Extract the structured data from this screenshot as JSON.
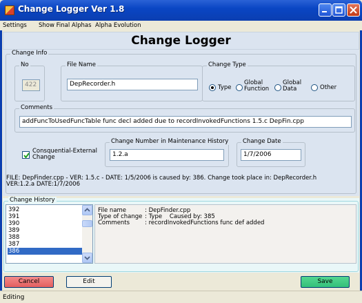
{
  "window": {
    "title": "Change Logger Ver 1.8"
  },
  "menu": {
    "items": [
      "Settings",
      "Show Final Alphas",
      "Alpha Evolution"
    ]
  },
  "header": {
    "title": "Change Logger"
  },
  "change_info": {
    "group_label": "Change Info",
    "no": {
      "label": "No",
      "value": "422"
    },
    "file_name": {
      "label": "File Name",
      "value": "DepRecorder.h"
    },
    "change_type": {
      "label": "Change Type",
      "options": [
        {
          "label": "Type",
          "selected": true
        },
        {
          "label": "Global Function",
          "line1": "Global",
          "line2": "Function",
          "selected": false
        },
        {
          "label": "Global Data",
          "line1": "Global",
          "line2": "Data",
          "selected": false
        },
        {
          "label": "Other",
          "selected": false
        }
      ]
    },
    "comments": {
      "label": "Comments",
      "value": "addFuncToUsedFuncTable func decl added due to recordInvokedFunctions 1.5.c DepFin.cpp"
    },
    "consequential": {
      "line1": "Consquential-External",
      "line2": "Change",
      "checked": true
    },
    "maintenance_number": {
      "label": "Change Number in Maintenance History",
      "value": "1.2.a"
    },
    "change_date": {
      "label": "Change Date",
      "value": "1/7/2006"
    },
    "summary_line1": "FILE: DepFinder.cpp - VER: 1.5.c - DATE: 1/5/2006 is caused by: 386. Change took place in: DepRecorder.h",
    "summary_line2": "VER:1.2.a DATE:1/7/2006"
  },
  "change_history": {
    "group_label": "Change History",
    "items": [
      "392",
      "391",
      "390",
      "389",
      "388",
      "387",
      "386"
    ],
    "selected": "386",
    "details": {
      "file_name_label": "File name",
      "file_name_value": ": DepFinder.cpp",
      "type_label": "Type of change",
      "type_value": ": Type    Caused by: 385",
      "comments_label": "Comments",
      "comments_value": ": recordInvokedFunctions func def added"
    }
  },
  "buttons": {
    "cancel": "Cancel",
    "edit": "Edit",
    "save": "Save"
  },
  "status": {
    "text": "Editing"
  },
  "colors": {
    "title_bar": "#0b46c4",
    "panel": "#dbe4f0",
    "history_panel": "#e9f7f8",
    "cancel": "#e35f5f",
    "save": "#33c07a",
    "selection": "#316ac5"
  }
}
